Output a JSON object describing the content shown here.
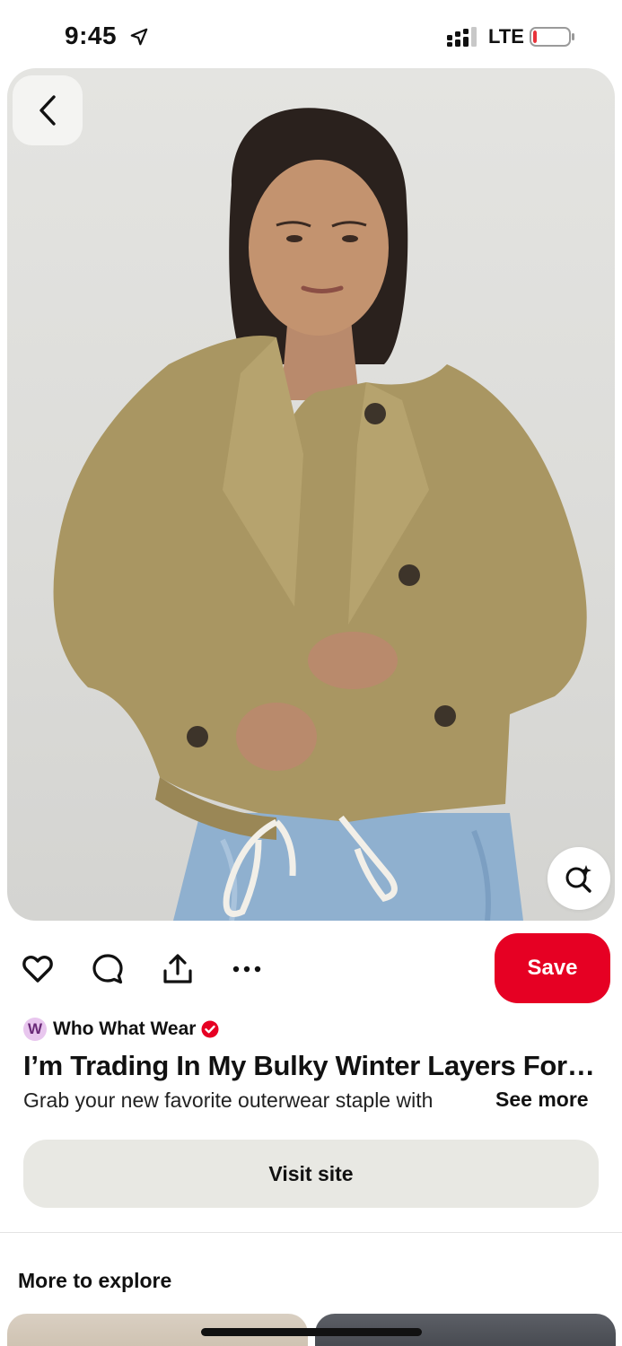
{
  "status_bar": {
    "time": "9:45",
    "network": "LTE",
    "battery_level": 0.1,
    "battery_color": "#e8333b"
  },
  "pin": {
    "back_icon": "chevron-left-icon",
    "visual_search_icon": "sparkle-search-icon"
  },
  "actions": {
    "like_icon": "heart-icon",
    "comment_icon": "comment-icon",
    "share_icon": "share-icon",
    "more_icon": "more-icon",
    "save_label": "Save",
    "save_color": "#e60023"
  },
  "creator": {
    "avatar_letter": "W",
    "name": "Who What Wear",
    "verified": true,
    "verified_color": "#e60023"
  },
  "title": "I’m Trading In My Bulky Winter Layers For…",
  "description": "Grab your new favorite outerwear staple with",
  "see_more_label": "See more",
  "visit_site_label": "Visit site",
  "more_to_explore_label": "More to explore"
}
